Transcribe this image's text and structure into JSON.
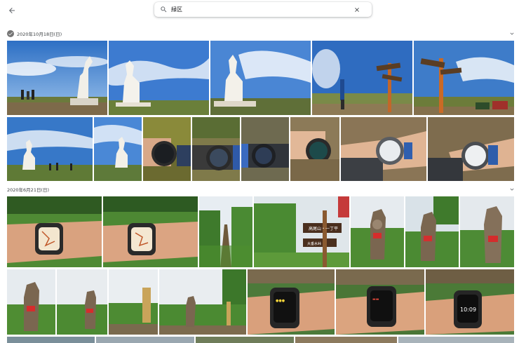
{
  "search": {
    "value": "緑区"
  },
  "sections": [
    {
      "date": "2020年10月18日(日)"
    },
    {
      "date": "2020年6月21日(日)"
    }
  ],
  "signs": {
    "top_text": "高尾山・一丁平",
    "bottom_text": "大垂水峠"
  },
  "watch": {
    "time": "10:09"
  },
  "colors": {
    "sky": "#3a78c6",
    "grass": "#4d7a2e",
    "accent": "#1a73e8"
  }
}
